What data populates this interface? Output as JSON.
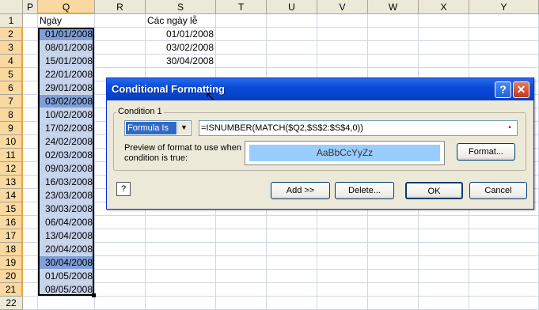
{
  "columns": [
    "P",
    "Q",
    "R",
    "S",
    "T",
    "U",
    "V",
    "W",
    "X",
    "Y"
  ],
  "rows": [
    "1",
    "2",
    "3",
    "4",
    "5",
    "6",
    "7",
    "8",
    "9",
    "10",
    "11",
    "12",
    "13",
    "14",
    "15",
    "16",
    "17",
    "18",
    "19",
    "20",
    "21",
    "22"
  ],
  "cells": {
    "Q1": "Ngày",
    "S1": "Các ngày lễ",
    "S2": "01/01/2008",
    "S3": "03/02/2008",
    "S4": "30/04/2008",
    "Q": [
      "01/01/2008",
      "08/01/2008",
      "15/01/2008",
      "22/01/2008",
      "29/01/2008",
      "03/02/2008",
      "10/02/2008",
      "17/02/2008",
      "24/02/2008",
      "02/03/2008",
      "09/03/2008",
      "16/03/2008",
      "23/03/2008",
      "30/03/2008",
      "06/04/2008",
      "13/04/2008",
      "20/04/2008",
      "30/04/2008",
      "01/05/2008",
      "08/05/2008"
    ]
  },
  "highlighted_q_rows": [
    2,
    7,
    19
  ],
  "dialog": {
    "title": "Conditional Formatting",
    "help_glyph": "?",
    "close_glyph": "✕",
    "group_label": "Condition 1",
    "condition_type": "Formula Is",
    "formula": "=ISNUMBER(MATCH($Q2,$S$2:$S$4,0))",
    "preview_label": "Preview of format to use when condition is true:",
    "preview_sample": "AaBbCcYyZz",
    "format_button": "Format...",
    "add_button": "Add >>",
    "delete_button": "Delete...",
    "ok_button": "OK",
    "cancel_button": "Cancel"
  },
  "colors": {
    "selection_fill": "#c6d3ec",
    "highlight_fill": "#7e9fd8",
    "preview_fill": "#99ccff",
    "title_bar": "#0a4bd8"
  }
}
